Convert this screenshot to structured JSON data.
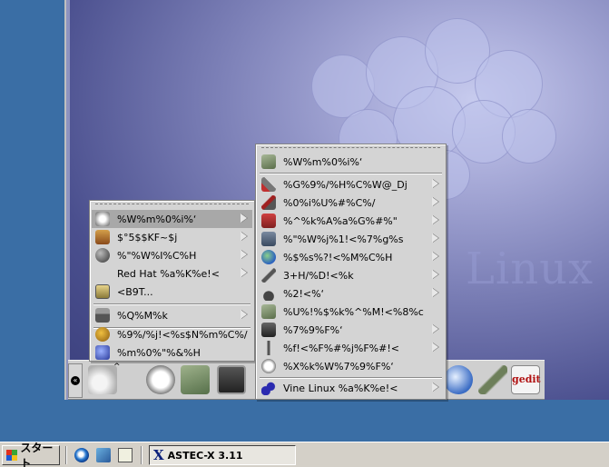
{
  "remote": {
    "watermark": "Linux"
  },
  "panel": {
    "icons": [
      "foot-icon",
      "help-icon",
      "toolbox-icon",
      "terminal-icon",
      "globe-icon",
      "pen-icon",
      "gedit-icon"
    ],
    "gedit_label": "gedit",
    "foot_caret": "^"
  },
  "main_menu": {
    "items": [
      {
        "label": "%W%m%0%i%‘",
        "icon": "foot-icon",
        "submenu": true,
        "active": true
      },
      {
        "label": "$°5$$KF~$j",
        "icon": "bag-icon",
        "submenu": true
      },
      {
        "label": "%\"%W%I%C%H",
        "icon": "ball-icon",
        "submenu": true
      },
      {
        "label": "Red Hat %a%K%e!<",
        "icon": "",
        "submenu": true
      },
      {
        "label": "<B9T...",
        "icon": "run-icon",
        "submenu": false
      },
      {
        "label": "%Q%M%k",
        "icon": "panel-icon",
        "submenu": true
      },
      {
        "label": "%9%/%j!<%s$N%m%C%/",
        "icon": "lock-icon",
        "submenu": false
      },
      {
        "label": "%m%0%\"%&%H",
        "icon": "logout-icon",
        "submenu": false
      }
    ]
  },
  "sub_menu": {
    "items": [
      {
        "label": "%W%m%0%i%‘",
        "icon": "box-icon",
        "submenu": false
      },
      {
        "label": "%G%9%/%H%C%W@_Dj",
        "icon": "tools-icon",
        "submenu": true
      },
      {
        "label": "%0%i%U%#%C%/",
        "icon": "paint-icon",
        "submenu": true
      },
      {
        "label": "%^%k%A%a%G%#%\"",
        "icon": "media-icon",
        "submenu": true
      },
      {
        "label": "%\"%W%j%1!<%7%g%s",
        "icon": "apps-icon",
        "submenu": true
      },
      {
        "label": "%$%s%?!<%M%C%H",
        "icon": "internet-icon",
        "submenu": true
      },
      {
        "label": "3+H/%D!<%k",
        "icon": "devtools-icon",
        "submenu": true
      },
      {
        "label": "%2!<%‘",
        "icon": "games-icon",
        "submenu": true
      },
      {
        "label": "%U%!%$%k%^%M!<%8%c",
        "icon": "filemanager-icon",
        "submenu": false
      },
      {
        "label": "%7%9%F%‘",
        "icon": "system-icon",
        "submenu": true
      },
      {
        "label": "%f!<%F%#%j%F%#!<",
        "icon": "utilities-icon",
        "submenu": true
      },
      {
        "label": "%X%k%W%7%9%F%‘",
        "icon": "help-system-icon",
        "submenu": false
      },
      {
        "label": "Vine Linux %a%K%e!<",
        "icon": "vine-icon",
        "submenu": true
      }
    ]
  },
  "taskbar": {
    "start_label": "スタート",
    "task_label": "ASTEC-X 3.11",
    "task_icon": "x-icon",
    "quicklaunch": [
      "ie-icon",
      "outlook-icon",
      "desktop-icon"
    ]
  },
  "colors": {
    "menu_bg": "#d4d4d4",
    "menu_active": "#a8a8a8",
    "taskbar_bg": "#d4d0c8",
    "host_desktop": "#3a6ea5"
  }
}
